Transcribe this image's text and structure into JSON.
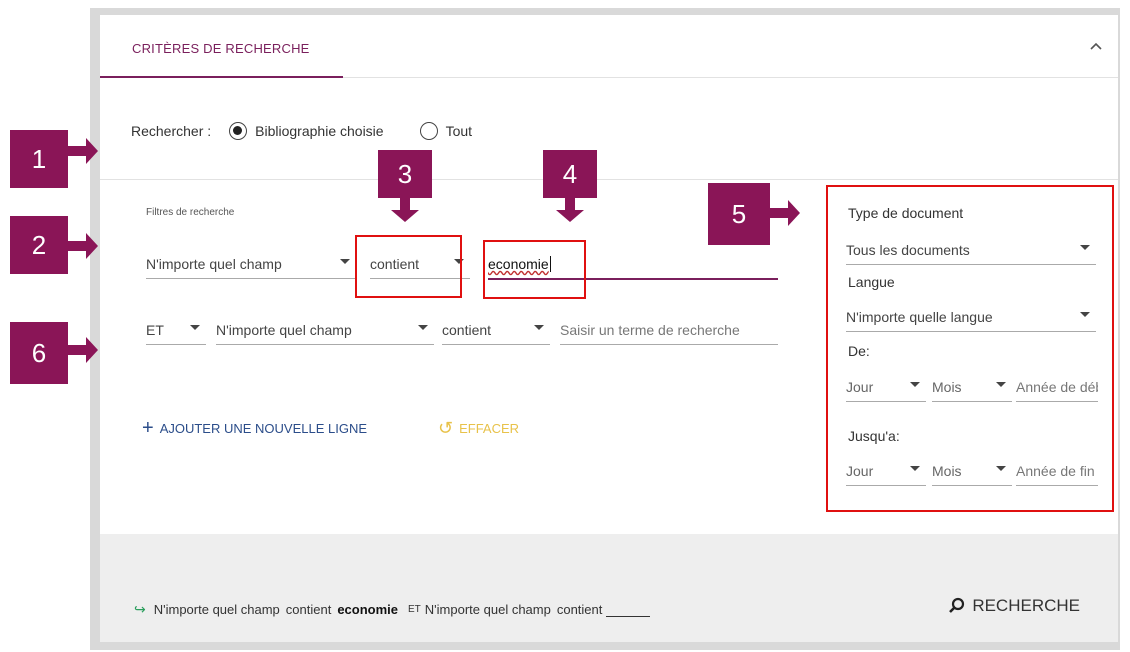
{
  "header": {
    "title": "CRITÈRES DE RECHERCHE",
    "collapse_icon": "chevron-up-icon"
  },
  "scope": {
    "label": "Rechercher :",
    "options": [
      {
        "label": "Bibliographie choisie",
        "checked": true
      },
      {
        "label": "Tout",
        "checked": false
      }
    ]
  },
  "filters": {
    "label": "Filtres de recherche",
    "row1": {
      "field": "N'importe quel champ",
      "operator": "contient",
      "value": "economie"
    },
    "row2": {
      "boolean": "ET",
      "field": "N'importe quel champ",
      "operator": "contient",
      "placeholder": "Saisir un terme de recherche"
    }
  },
  "actions": {
    "add_line": "AJOUTER UNE NOUVELLE LIGNE",
    "clear": "EFFACER"
  },
  "side": {
    "doc_type_label": "Type de document",
    "doc_type_value": "Tous les documents",
    "lang_label": "Langue",
    "lang_value": "N'importe quelle langue",
    "from_label": "De:",
    "to_label": "Jusqu'a:",
    "day": "Jour",
    "month": "Mois",
    "year_from_placeholder": "Année de début",
    "year_to_placeholder": "Année de fin"
  },
  "summary": {
    "field1": "N'importe quel champ",
    "op1": "contient",
    "value1": "economie",
    "bool": "ET",
    "field2": "N'importe quel champ",
    "op2": "contient"
  },
  "search_button": "RECHERCHE",
  "annotations": [
    "1",
    "2",
    "3",
    "4",
    "5",
    "6"
  ],
  "colors": {
    "accent": "#7a1f5c",
    "annotation": "#8a1557",
    "highlight_box": "#e01010",
    "clear": "#e8c24a",
    "link": "#2b4d8a"
  }
}
